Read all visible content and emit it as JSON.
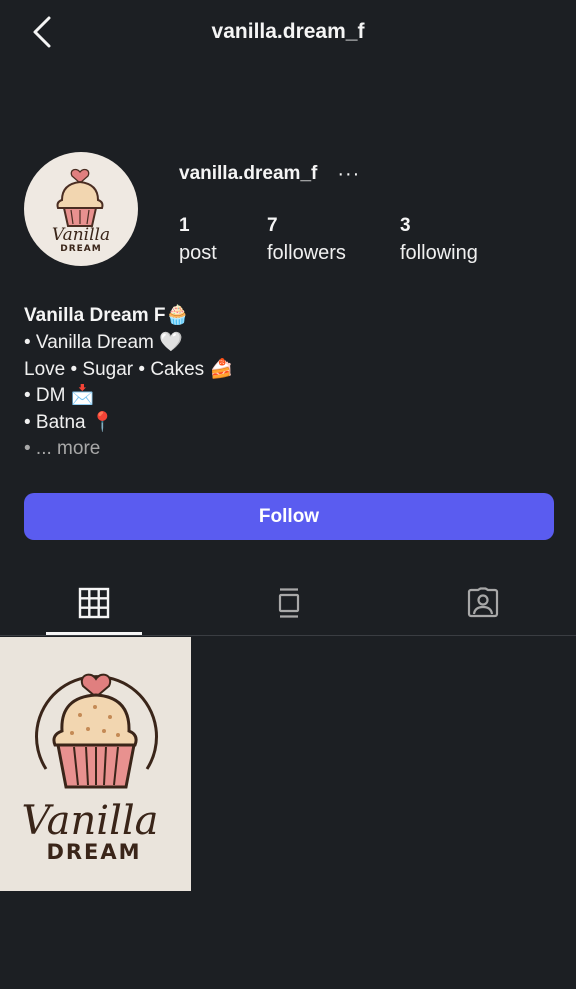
{
  "header": {
    "title": "vanilla.dream_f"
  },
  "profile": {
    "username": "vanilla.dream_f",
    "more": "···",
    "stats": {
      "posts_count": "1",
      "posts_label": "post",
      "followers_count": "7",
      "followers_label": "followers",
      "following_count": "3",
      "following_label": "following"
    },
    "avatar_logo": {
      "line1": "Vanilla",
      "line2": "DREAM"
    }
  },
  "bio": {
    "name": "Vanilla Dream F🧁",
    "lines": [
      "• Vanilla Dream 🤍",
      "Love • Sugar • Cakes 🍰",
      "• DM 📩",
      "• Batna 📍"
    ],
    "more": "• ... more"
  },
  "actions": {
    "follow_label": "Follow"
  },
  "tabs": [
    {
      "name": "grid",
      "icon": "grid-icon",
      "active": true
    },
    {
      "name": "feed",
      "icon": "feed-icon",
      "active": false
    },
    {
      "name": "tagged",
      "icon": "tagged-icon",
      "active": false
    }
  ],
  "posts": [
    {
      "logo_line1": "Vanilla",
      "logo_line2": "DREAM"
    }
  ],
  "colors": {
    "background": "#1c1f23",
    "accent": "#5a5cf0",
    "text": "#f5f5f5"
  }
}
